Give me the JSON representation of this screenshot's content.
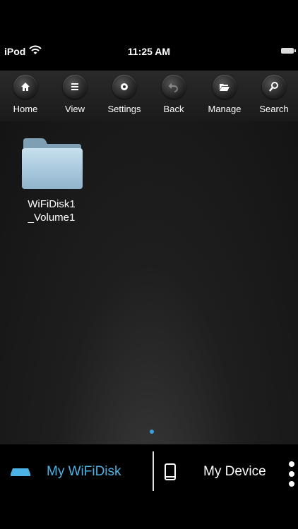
{
  "status_bar": {
    "device": "iPod",
    "time": "11:25 AM",
    "wifi_icon": "wifi-icon",
    "battery_icon": "battery-icon"
  },
  "toolbar": {
    "items": [
      {
        "label": "Home",
        "icon": "home-icon"
      },
      {
        "label": "View",
        "icon": "list-icon"
      },
      {
        "label": "Settings",
        "icon": "gear-icon"
      },
      {
        "label": "Back",
        "icon": "back-arrow-icon"
      },
      {
        "label": "Manage",
        "icon": "folder-open-icon"
      },
      {
        "label": "Search",
        "icon": "search-icon"
      }
    ]
  },
  "content": {
    "items": [
      {
        "type": "folder",
        "label": "WiFiDisk1\n_Volume1",
        "icon": "folder-icon"
      }
    ],
    "page_indicator": {
      "pages": 1,
      "current": 1
    }
  },
  "tab_bar": {
    "tabs": [
      {
        "label": "My WiFiDisk",
        "icon": "disk-icon",
        "active": true,
        "color": "#4db3e6"
      },
      {
        "label": "My Device",
        "icon": "phone-icon",
        "active": false
      }
    ],
    "more_icon": "more-vertical-icon"
  }
}
